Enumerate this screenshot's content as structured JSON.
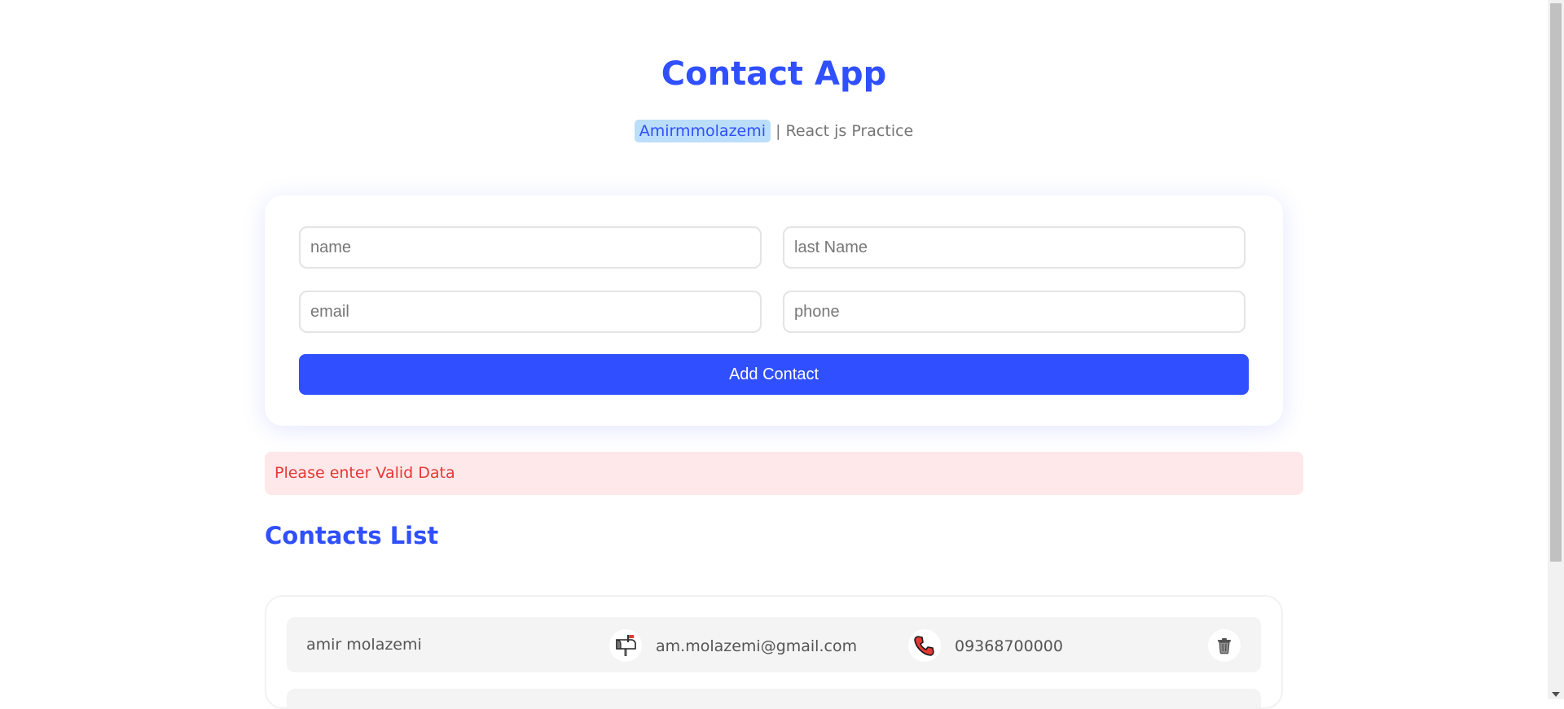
{
  "header": {
    "title": "Contact App",
    "author": "Amirmmolazemi",
    "subtitle": "| React js Practice"
  },
  "form": {
    "name_placeholder": "name",
    "lastname_placeholder": "last Name",
    "email_placeholder": "email",
    "phone_placeholder": "phone",
    "submit_label": "Add Contact"
  },
  "alert": {
    "message": "Please enter Valid Data"
  },
  "contacts": {
    "title": "Contacts List",
    "items": [
      {
        "name": "amir molazemi",
        "email": "am.molazemi@gmail.com",
        "phone": "09368700000"
      }
    ]
  },
  "colors": {
    "accent": "#304ffe",
    "badge_bg": "#bbdefb",
    "alert_bg": "#ffe8ea",
    "alert_text": "#e53935"
  },
  "icons": [
    "mailbox-icon",
    "telephone-icon",
    "trash-icon"
  ]
}
